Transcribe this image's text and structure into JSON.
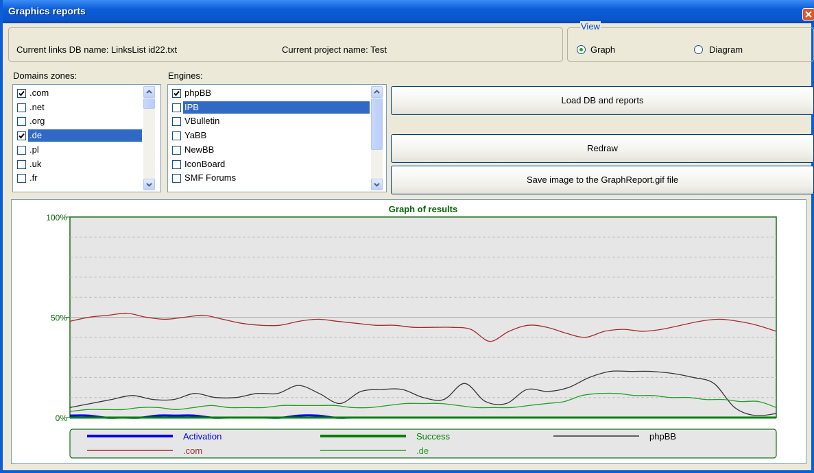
{
  "window": {
    "title": "Graphics reports"
  },
  "info": {
    "db_label": "Current links DB name: LinksList id22.txt",
    "project_label": "Current project name: Test"
  },
  "view": {
    "legend": "View",
    "options": [
      {
        "label": "Graph",
        "selected": true
      },
      {
        "label": "Diagram",
        "selected": false
      }
    ]
  },
  "domains": {
    "label": "Domains zones:",
    "items": [
      {
        "label": ".com",
        "checked": true,
        "selected": false
      },
      {
        "label": ".net",
        "checked": false,
        "selected": false
      },
      {
        "label": ".org",
        "checked": false,
        "selected": false
      },
      {
        "label": ".de",
        "checked": true,
        "selected": true
      },
      {
        "label": ".pl",
        "checked": false,
        "selected": false
      },
      {
        "label": ".uk",
        "checked": false,
        "selected": false
      },
      {
        "label": ".fr",
        "checked": false,
        "selected": false
      }
    ]
  },
  "engines": {
    "label": "Engines:",
    "items": [
      {
        "label": "phpBB",
        "checked": true,
        "selected": false
      },
      {
        "label": "IPB",
        "checked": false,
        "selected": true
      },
      {
        "label": "VBulletin",
        "checked": false,
        "selected": false
      },
      {
        "label": "YaBB",
        "checked": false,
        "selected": false
      },
      {
        "label": "NewBB",
        "checked": false,
        "selected": false
      },
      {
        "label": "IconBoard",
        "checked": false,
        "selected": false
      },
      {
        "label": "SMF Forums",
        "checked": false,
        "selected": false
      }
    ]
  },
  "buttons": {
    "load": "Load DB and reports",
    "redraw": "Redraw",
    "save": "Save image to the GraphReport.gif file"
  },
  "chart_data": {
    "type": "line",
    "title": "Graph of results",
    "xlabel": "",
    "ylabel": "",
    "ylim": [
      0,
      100
    ],
    "yticks": [
      "100%",
      "50%",
      "0%"
    ],
    "grid": true,
    "legend_position": "bottom",
    "x": [
      0,
      2.5,
      5,
      7.5,
      10,
      12.5,
      15,
      17.5,
      20,
      22.5,
      25,
      27.5,
      30,
      32.5,
      35,
      37.5,
      40,
      42.5,
      45,
      47.5,
      50,
      52.5,
      55,
      57.5,
      60,
      62.5,
      65,
      67.5,
      70,
      72.5,
      75,
      77.5,
      80,
      82.5,
      85,
      87.5,
      90,
      92.5,
      95,
      97.5,
      100
    ],
    "series": [
      {
        "name": "Activation",
        "color": "#0000ff",
        "values": [
          1,
          1,
          0,
          0,
          0,
          1,
          1,
          1,
          0,
          0,
          0,
          0,
          0,
          1,
          1,
          0,
          0,
          0,
          0,
          0,
          0,
          0,
          0,
          0,
          0,
          0,
          0,
          0,
          0,
          0,
          0,
          0,
          0,
          0,
          0,
          0,
          0,
          0,
          0,
          0,
          0
        ]
      },
      {
        "name": "Success",
        "color": "#008000",
        "values": [
          0,
          0,
          0,
          0,
          0,
          0,
          0,
          0,
          0,
          0,
          0,
          0,
          0,
          0,
          0,
          0,
          0,
          0,
          0,
          0,
          0,
          0,
          0,
          0,
          0,
          0,
          0,
          0,
          0,
          0,
          0,
          0,
          0,
          0,
          0,
          0,
          0,
          0,
          0,
          0,
          0
        ]
      },
      {
        "name": "phpBB",
        "color": "#333333",
        "values": [
          5,
          7,
          9,
          11,
          9,
          9,
          12,
          10,
          10,
          12,
          12,
          16,
          12,
          7,
          13,
          14,
          14,
          10,
          9,
          17,
          8,
          7,
          14,
          13,
          15,
          20,
          23,
          23,
          23,
          22,
          20,
          17,
          5,
          1,
          2
        ]
      },
      {
        "name": ".com",
        "color": "#a52a2a",
        "values": [
          48,
          50,
          51,
          52,
          50,
          49,
          50,
          51,
          49,
          47,
          46,
          46,
          48,
          49,
          48,
          47,
          46,
          46,
          45,
          45,
          45,
          44,
          38,
          43,
          46,
          45,
          42,
          40,
          43,
          44,
          43,
          44,
          46,
          48,
          49,
          48,
          46,
          43
        ]
      },
      {
        "name": ".de",
        "color": "#22a022",
        "values": [
          3,
          4,
          4,
          4,
          5,
          5,
          4,
          5,
          6,
          5,
          5,
          5,
          6,
          6,
          6,
          6,
          5,
          5,
          6,
          7,
          7,
          7,
          6,
          5,
          5,
          5,
          6,
          7,
          8,
          11,
          12,
          12,
          11,
          11,
          10,
          10,
          9,
          9,
          8,
          8,
          5
        ]
      }
    ]
  }
}
